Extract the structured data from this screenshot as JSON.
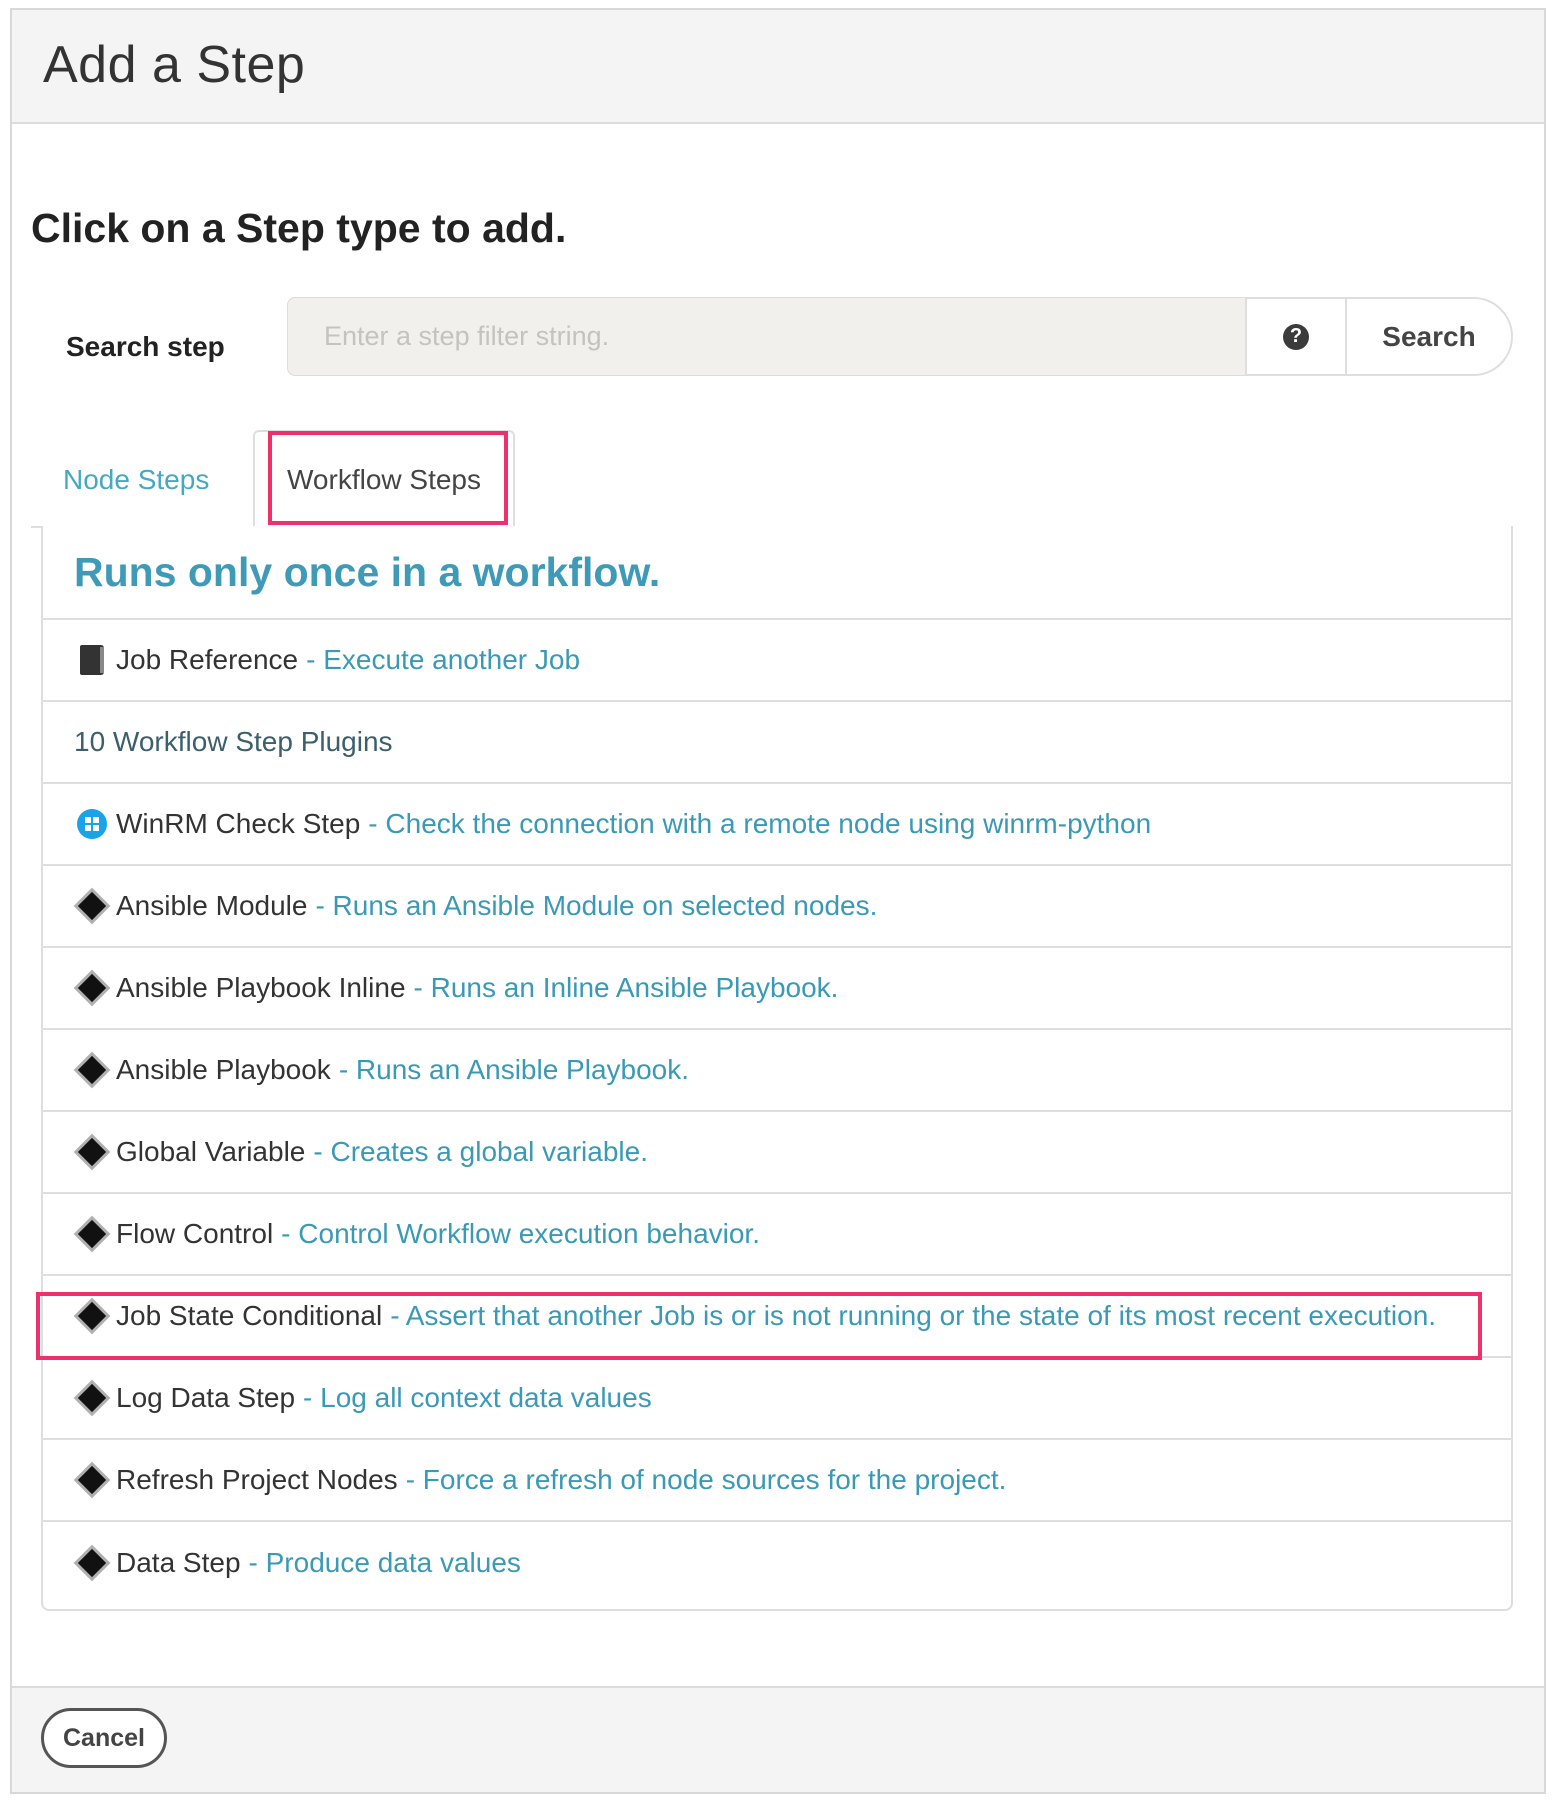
{
  "modal": {
    "title": "Add a Step",
    "instructions": "Click on a Step type to add.",
    "cancel_label": "Cancel"
  },
  "search": {
    "label": "Search step",
    "placeholder": "Enter a step filter string.",
    "help_icon": "question-circle-icon",
    "help_glyph": "?",
    "button_label": "Search"
  },
  "tabs": [
    {
      "label": "Node Steps",
      "active": false
    },
    {
      "label": "Workflow Steps",
      "active": true
    }
  ],
  "list": {
    "heading": "Runs only once in a workflow.",
    "job_reference": {
      "name": "Job Reference",
      "desc": "- Execute another Job",
      "icon": "book-icon"
    },
    "plugins_group": "10 Workflow Step Plugins",
    "plugins": [
      {
        "name": "WinRM Check Step",
        "desc": "- Check the connection with a remote node using winrm-python",
        "icon": "windows-icon"
      },
      {
        "name": "Ansible Module",
        "desc": "- Runs an Ansible Module on selected nodes.",
        "icon": "diamond-icon"
      },
      {
        "name": "Ansible Playbook Inline",
        "desc": "- Runs an Inline Ansible Playbook.",
        "icon": "diamond-icon"
      },
      {
        "name": "Ansible Playbook",
        "desc": "- Runs an Ansible Playbook.",
        "icon": "diamond-icon"
      },
      {
        "name": "Global Variable",
        "desc": "- Creates a global variable.",
        "icon": "diamond-icon"
      },
      {
        "name": "Flow Control",
        "desc": "- Control Workflow execution behavior.",
        "icon": "diamond-icon"
      },
      {
        "name": "Job State Conditional",
        "desc": "- Assert that another Job is or is not running or the state of its most recent execution.",
        "icon": "diamond-icon"
      },
      {
        "name": "Log Data Step",
        "desc": "- Log all context data values",
        "icon": "diamond-icon"
      },
      {
        "name": "Refresh Project Nodes",
        "desc": "- Force a refresh of node sources for the project.",
        "icon": "diamond-icon"
      },
      {
        "name": "Data Step",
        "desc": "- Produce data values",
        "icon": "diamond-icon"
      }
    ]
  },
  "colors": {
    "accent": "#3a99b5",
    "highlight": "#f0306c"
  }
}
